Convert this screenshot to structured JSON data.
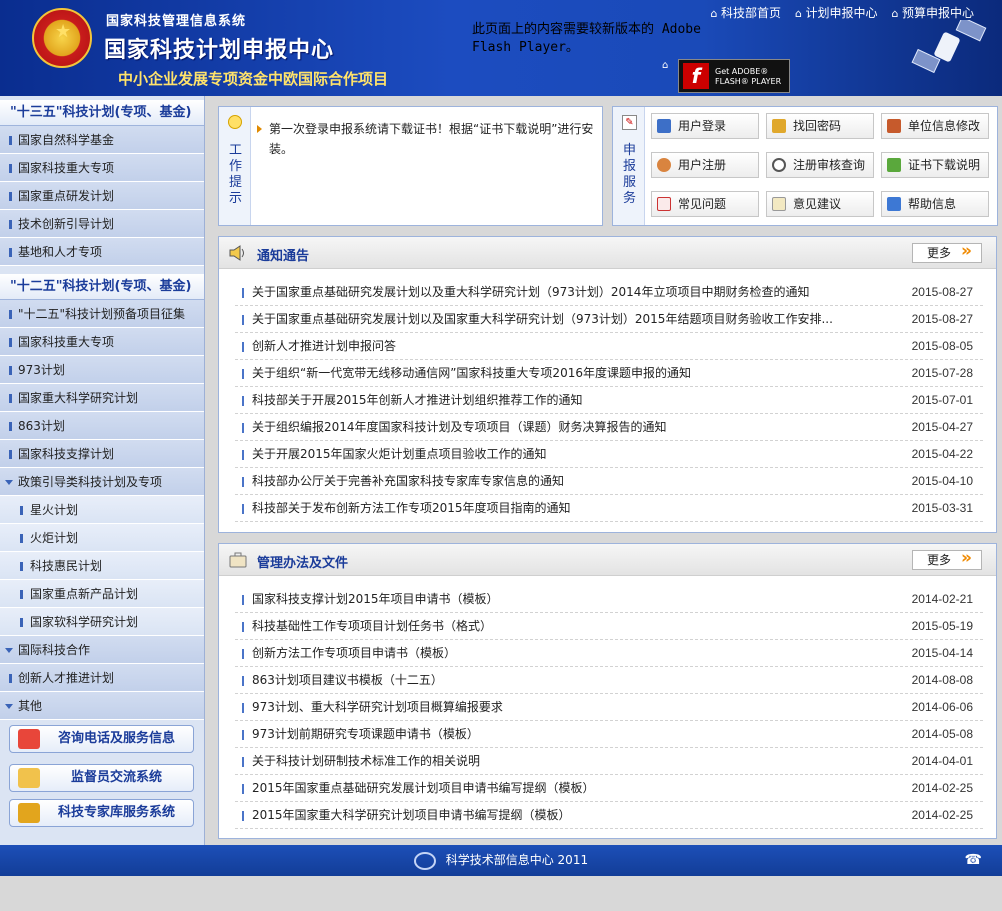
{
  "header": {
    "system_name": "国家科技管理信息系统",
    "center_title": "国家科技计划申报中心",
    "project_name": "中小企业发展专项资金中欧国际合作项目",
    "flash_message": "此页面上的内容需要较新版本的 Adobe Flash Player。",
    "flash_button": {
      "line1": "Get ADOBE®",
      "line2": "FLASH® PLAYER"
    },
    "nav": [
      "科技部首页",
      "计划申报中心",
      "预算申报中心"
    ]
  },
  "sidebar": {
    "sections": [
      {
        "title": "\"十三五\"科技计划(专项、基金)",
        "items": [
          "国家自然科学基金",
          "国家科技重大专项",
          "国家重点研发计划",
          "技术创新引导计划",
          "基地和人才专项"
        ]
      },
      {
        "title": "\"十二五\"科技计划(专项、基金)",
        "items": [
          "\"十二五\"科技计划预备项目征集",
          "国家科技重大专项",
          "973计划",
          "国家重大科学研究计划",
          "863计划",
          "国家科技支撑计划"
        ]
      }
    ],
    "policy_group": "政策引导类科技计划及专项",
    "policy_items": [
      "星火计划",
      "火炬计划",
      "科技惠民计划",
      "国家重点新产品计划",
      "国家软科学研究计划"
    ],
    "tail_items": [
      "国际科技合作",
      "创新人才推进计划",
      "其他"
    ],
    "service_buttons": [
      "咨询电话及服务信息",
      "监督员交流系统",
      "科技专家库服务系统"
    ]
  },
  "tips": {
    "label": "工作提示",
    "text": "第一次登录申报系统请下载证书！根据“证书下载说明”进行安装。"
  },
  "services": {
    "label": "申报服务",
    "buttons": [
      "用户登录",
      "找回密码",
      "单位信息修改",
      "用户注册",
      "注册审核查询",
      "证书下载说明",
      "常见问题",
      "意见建议",
      "帮助信息"
    ]
  },
  "news": {
    "title": "通知通告",
    "more": "更多",
    "items": [
      {
        "title": "关于国家重点基础研究发展计划以及重大科学研究计划（973计划）2014年立项项目中期财务检查的通知",
        "date": "2015-08-27"
      },
      {
        "title": "关于国家重点基础研究发展计划以及国家重大科学研究计划（973计划）2015年结题项目财务验收工作安排...",
        "date": "2015-08-27"
      },
      {
        "title": "创新人才推进计划申报问答",
        "date": "2015-08-05"
      },
      {
        "title": "关于组织“新一代宽带无线移动通信网”国家科技重大专项2016年度课题申报的通知",
        "date": "2015-07-28"
      },
      {
        "title": "科技部关于开展2015年创新人才推进计划组织推荐工作的通知",
        "date": "2015-07-01"
      },
      {
        "title": "关于组织编报2014年度国家科技计划及专项项目（课题）财务决算报告的通知",
        "date": "2015-04-27"
      },
      {
        "title": "关于开展2015年国家火炬计划重点项目验收工作的通知",
        "date": "2015-04-22"
      },
      {
        "title": "科技部办公厅关于完善补充国家科技专家库专家信息的通知",
        "date": "2015-04-10"
      },
      {
        "title": "科技部关于发布创新方法工作专项2015年度项目指南的通知",
        "date": "2015-03-31"
      }
    ]
  },
  "docs": {
    "title": "管理办法及文件",
    "more": "更多",
    "items": [
      {
        "title": "国家科技支撑计划2015年项目申请书（模板）",
        "date": "2014-02-21"
      },
      {
        "title": "科技基础性工作专项项目计划任务书（格式）",
        "date": "2015-05-19"
      },
      {
        "title": "创新方法工作专项项目申请书（模板）",
        "date": "2015-04-14"
      },
      {
        "title": "863计划项目建议书模板（十二五）",
        "date": "2014-08-08"
      },
      {
        "title": "973计划、重大科学研究计划项目概算编报要求",
        "date": "2014-06-06"
      },
      {
        "title": "973计划前期研究专项课题申请书（模板）",
        "date": "2014-05-08"
      },
      {
        "title": "关于科技计划研制技术标准工作的相关说明",
        "date": "2014-04-01"
      },
      {
        "title": "2015年国家重点基础研究发展计划项目申请书编写提纲（模板）",
        "date": "2014-02-25"
      },
      {
        "title": "2015年国家重大科学研究计划项目申请书编写提纲（模板）",
        "date": "2014-02-25"
      }
    ]
  },
  "footer": {
    "text": "科学技术部信息中心  2011"
  }
}
